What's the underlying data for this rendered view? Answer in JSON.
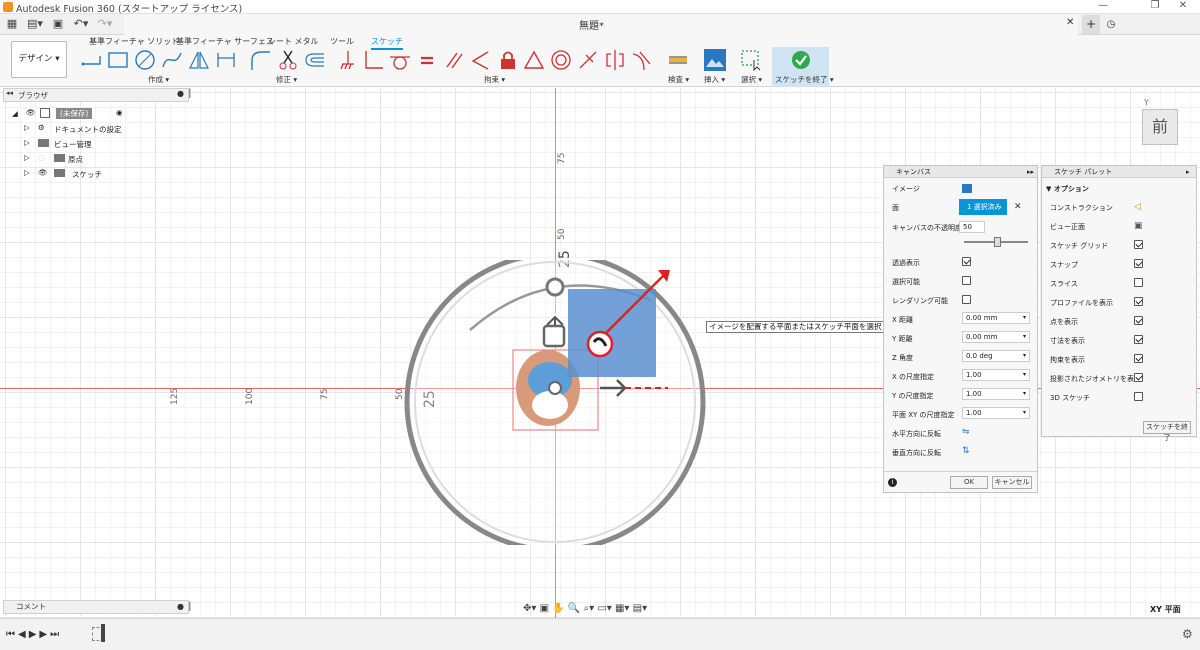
{
  "window": {
    "title": "Autodesk Fusion 360 (スタートアップ ライセンス)",
    "doc_title": "無題*"
  },
  "colors": {
    "accent": "#0696d7",
    "x_axis": "#e04040",
    "y_axis": "#40c040",
    "image_blue": "#5b8fd0"
  },
  "ribbon": {
    "design_button": "デザイン ▾",
    "tabs": [
      {
        "label": "基準フィーチャ ソリッド"
      },
      {
        "label": "基準フィーチャ サーフェス"
      },
      {
        "label": "シート メタル"
      },
      {
        "label": "ツール"
      },
      {
        "label": "スケッチ"
      }
    ],
    "groups": {
      "create": "作成 ▾",
      "modify": "修正 ▾",
      "constrain": "拘束 ▾",
      "inspect": "検査 ▾",
      "insert": "挿入 ▾",
      "select": "選択 ▾",
      "finish": "スケッチを終了 ▾"
    },
    "icons": [
      "line-icon",
      "rectangle-icon",
      "circle-icon",
      "spline-icon",
      "mirror-icon",
      "dimension-icon",
      "fillet-icon",
      "trim-icon",
      "offset-icon",
      "fix-icon",
      "coincident-icon",
      "tangent-icon",
      "equal-icon",
      "parallel-icon",
      "perpendicular-icon",
      "lock-icon",
      "triangle-icon",
      "concentric-icon",
      "midpoint-icon",
      "symmetry-icon",
      "curvature-icon"
    ]
  },
  "browser": {
    "title": "ブラウザ",
    "items": [
      {
        "label": "(未保存)"
      },
      {
        "label": "ドキュメントの設定"
      },
      {
        "label": "ビュー管理"
      },
      {
        "label": "原点"
      },
      {
        "label": "スケッチ"
      }
    ]
  },
  "comment": {
    "title": "コメント"
  },
  "axis_labels": {
    "y": [
      "75",
      "50",
      "25"
    ],
    "x": [
      "125",
      "100",
      "75",
      "50",
      "25"
    ]
  },
  "tooltip": "イメージを配置する平面またはスケッチ平面を選択",
  "canvas_panel": {
    "title": "キャンバス",
    "image_label": "イメージ",
    "face_label": "面",
    "face_button": "1 選択済み",
    "opacity_label": "キャンバスの不透明度",
    "opacity_value": "50",
    "opacity_fraction": 0.5,
    "display_through": "透過表示",
    "selectable": "選択可能",
    "render": "レンダリング可能",
    "x_distance": {
      "label": "X 距離",
      "value": "0.00 mm"
    },
    "y_distance": {
      "label": "Y 距離",
      "value": "0.00 mm"
    },
    "z_angle": {
      "label": "Z 角度",
      "value": "0.0 deg"
    },
    "x_scale": {
      "label": "X の尺度指定",
      "value": "1.00"
    },
    "y_scale": {
      "label": "Y の尺度指定",
      "value": "1.00"
    },
    "xy_scale": {
      "label": "平面 XY の尺度指定",
      "value": "1.00"
    },
    "flip_h": "水平方向に反転",
    "flip_v": "垂直方向に反転",
    "ok": "OK",
    "cancel": "キャンセル"
  },
  "sketch_palette": {
    "title": "スケッチ パレット",
    "section": "▼ オプション",
    "items": [
      {
        "label": "コンストラクション",
        "type": "icon"
      },
      {
        "label": "ビュー正面",
        "type": "icon"
      },
      {
        "label": "スケッチ グリッド",
        "checked": true
      },
      {
        "label": "スナップ",
        "checked": true
      },
      {
        "label": "スライス",
        "checked": false
      },
      {
        "label": "プロファイルを表示",
        "checked": true
      },
      {
        "label": "点を表示",
        "checked": true
      },
      {
        "label": "寸法を表示",
        "checked": true
      },
      {
        "label": "拘束を表示",
        "checked": true
      },
      {
        "label": "投影されたジオメトリを表示",
        "checked": true
      },
      {
        "label": "3D スケッチ",
        "checked": false
      }
    ],
    "finish_button": "スケッチを終了"
  },
  "viewcube": {
    "face": "前",
    "top_label": "Y"
  },
  "status": {
    "plane": "XY 平面"
  }
}
